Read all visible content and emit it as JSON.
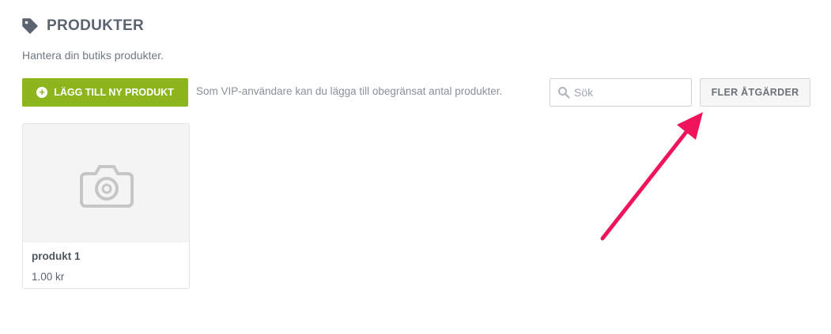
{
  "header": {
    "title": "PRODUKTER",
    "subtitle": "Hantera din butiks produkter."
  },
  "toolbar": {
    "add_button_label": "LÄGG TILL NY PRODUKT",
    "vip_note": "Som VIP-användare kan du lägga till obegränsat antal produkter.",
    "search_placeholder": "Sök",
    "search_value": "",
    "more_actions_label": "FLER ÅTGÄRDER"
  },
  "products": [
    {
      "name": "produkt 1",
      "price": "1.00 kr",
      "image_icon": "camera-icon"
    }
  ],
  "colors": {
    "accent_green": "#8cb51e",
    "annotation_arrow": "#f0155a",
    "title_text": "#5b6370"
  },
  "icons": {
    "header": "tag-icon",
    "add_button": "plus-circle-icon",
    "search": "search-icon",
    "annotation": "arrow-annotation"
  }
}
